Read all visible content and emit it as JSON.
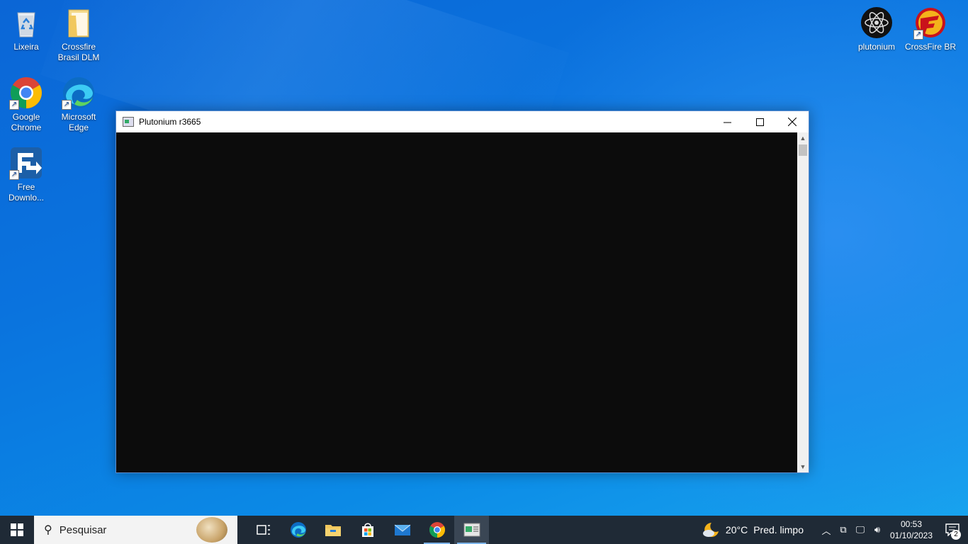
{
  "desktop": {
    "icons": [
      {
        "label_1": "Lixeira",
        "label_2": "",
        "icon": "recycle-bin-icon"
      },
      {
        "label_1": "Crossfire",
        "label_2": "Brasil DLM",
        "icon": "folder-icon"
      },
      {
        "label_1": "Google",
        "label_2": "Chrome",
        "icon": "chrome-icon"
      },
      {
        "label_1": "Microsoft",
        "label_2": "Edge",
        "icon": "edge-icon"
      },
      {
        "label_1": "Free",
        "label_2": "Downlo...",
        "icon": "free-download-manager-icon"
      },
      {
        "label_1": "plutonium",
        "label_2": "",
        "icon": "plutonium-icon"
      },
      {
        "label_1": "CrossFire BR",
        "label_2": "",
        "icon": "crossfire-icon"
      }
    ]
  },
  "window": {
    "title": "Plutonium r3665",
    "minimize_glyph": "—",
    "maximize_glyph": "☐",
    "close_glyph": "✕",
    "console_bg": "#0c0c0c"
  },
  "taskbar": {
    "search_placeholder": "Pesquisar",
    "apps": [
      "task-view",
      "edge",
      "file-explorer",
      "microsoft-store",
      "mail",
      "chrome",
      "console"
    ],
    "weather": {
      "temp": "20°C",
      "condition": "Pred. limpo"
    },
    "clock": {
      "time": "00:53",
      "date": "01/10/2023"
    },
    "notification_count": "2"
  }
}
